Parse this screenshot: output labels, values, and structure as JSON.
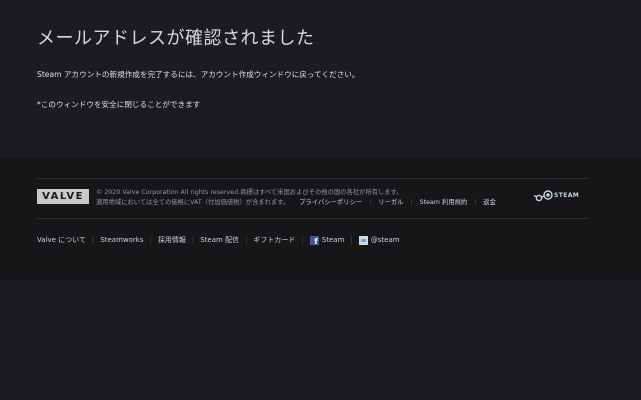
{
  "page": {
    "title": "メールアドレスが確認されました",
    "message": "Steam アカウントの新規作成を完了するには、アカウント作成ウィンドウに戻ってください。",
    "note": "*このウィンドウを安全に閉じることができます"
  },
  "footer": {
    "valve_logo_text": "VALVE",
    "legal_line1": "© 2020 Valve Corporation All rights reserved.商標はすべて米国およびその他の国の各社が所有します。",
    "legal_line2": "適用地域においては全ての価格にVAT（付加価値税）が含まれます。",
    "legal_links": {
      "privacy": "プライバシーポリシー",
      "legal": "リーガル",
      "ssa": "Steam 利用規約",
      "refunds": "返金"
    },
    "steam_logo_text": "STEAM",
    "links": {
      "about_valve": "Valve について",
      "steamworks": "Steamworks",
      "jobs": "採用情報",
      "distribution": "Steam 配信",
      "gift_cards": "ギフトカード",
      "facebook": "Steam",
      "twitter": "@steam"
    }
  }
}
